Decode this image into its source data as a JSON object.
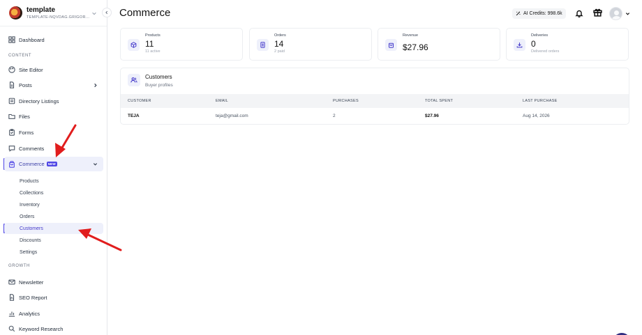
{
  "brand": {
    "name": "template",
    "subtitle": "TEMPLATE-NQVDAG.GRIGOR..."
  },
  "sidebar": {
    "top_items": [
      {
        "label": "Dashboard",
        "icon": "grid-icon"
      }
    ],
    "content_label": "CONTENT",
    "content_items": [
      {
        "label": "Site Editor",
        "icon": "palette-icon"
      },
      {
        "label": "Posts",
        "icon": "document-icon"
      },
      {
        "label": "Directory Listings",
        "icon": "list-icon"
      },
      {
        "label": "Files",
        "icon": "folder-icon"
      },
      {
        "label": "Forms",
        "icon": "clipboard-icon"
      },
      {
        "label": "Comments",
        "icon": "comment-icon"
      }
    ],
    "commerce": {
      "label": "Commerce",
      "badge": "NEW",
      "icon": "shopping-bag-icon"
    },
    "commerce_sub": [
      "Products",
      "Collections",
      "Inventory",
      "Orders",
      "Customers",
      "Discounts",
      "Settings"
    ],
    "active_sub": "Customers",
    "growth_label": "GROWTH",
    "growth_items": [
      {
        "label": "Newsletter",
        "icon": "mail-icon"
      },
      {
        "label": "SEO Report",
        "icon": "report-icon"
      },
      {
        "label": "Analytics",
        "icon": "chart-icon"
      },
      {
        "label": "Keyword Research",
        "icon": "search-icon"
      }
    ]
  },
  "header": {
    "title": "Commerce",
    "credits": "AI Credits: 998.6k"
  },
  "stats": [
    {
      "label": "Products",
      "value": "11",
      "sub": "11 active",
      "icon": "box-icon"
    },
    {
      "label": "Orders",
      "value": "14",
      "sub": "2 paid",
      "icon": "receipt-icon"
    },
    {
      "label": "Revenue",
      "value": "$27.96",
      "sub": "",
      "icon": "bag-icon"
    },
    {
      "label": "Deliveries",
      "value": "0",
      "sub": "Delivered orders",
      "icon": "download-icon"
    }
  ],
  "customers": {
    "title": "Customers",
    "subtitle": "Buyer profiles",
    "columns": [
      "CUSTOMER",
      "EMAIL",
      "PURCHASES",
      "TOTAL SPENT",
      "LAST PURCHASE"
    ],
    "rows": [
      {
        "customer": "TEJA",
        "email": "teja@gmail.com",
        "purchases": "2",
        "total": "$27.96",
        "last": "Aug 14, 2026"
      }
    ]
  },
  "colors": {
    "accent": "#4f46e5",
    "annotation": "#e11d1d"
  }
}
